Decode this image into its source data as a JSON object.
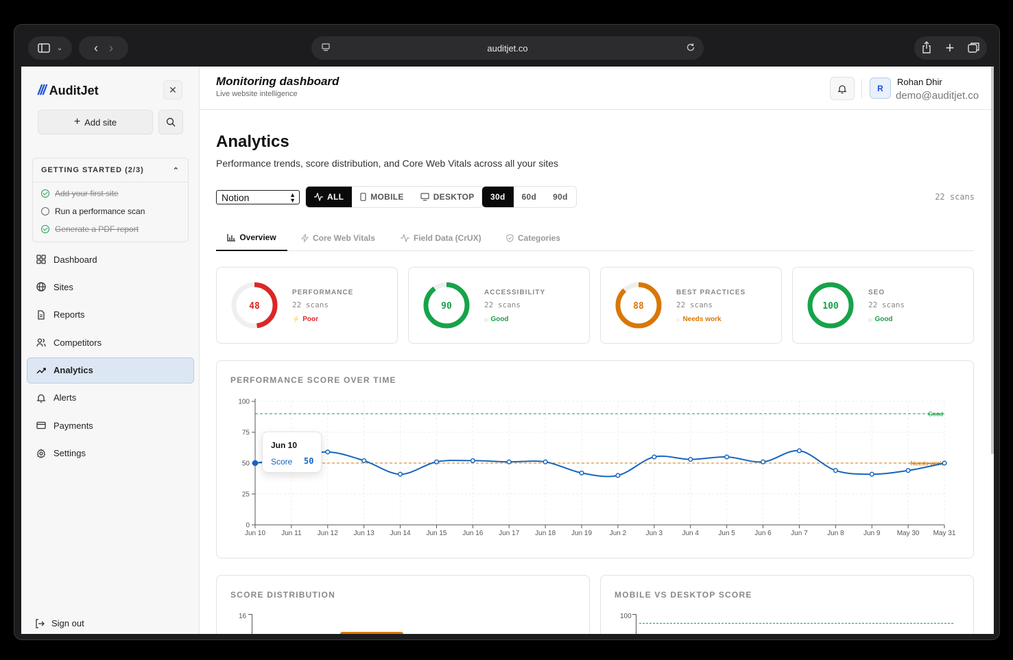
{
  "browser": {
    "url": "auditjet.co"
  },
  "sidebar": {
    "brand": "AuditJet",
    "add_site_label": "Add site",
    "getting_started": {
      "title": "GETTING STARTED (2/3)",
      "items": [
        {
          "label": "Add your first site",
          "done": true
        },
        {
          "label": "Run a performance scan",
          "done": false
        },
        {
          "label": "Generate a PDF report",
          "done": true
        }
      ]
    },
    "nav": [
      {
        "label": "Dashboard",
        "icon": "grid-icon"
      },
      {
        "label": "Sites",
        "icon": "globe-icon"
      },
      {
        "label": "Reports",
        "icon": "document-icon"
      },
      {
        "label": "Competitors",
        "icon": "users-icon"
      },
      {
        "label": "Analytics",
        "icon": "trend-icon",
        "active": true
      },
      {
        "label": "Alerts",
        "icon": "bell-icon"
      },
      {
        "label": "Payments",
        "icon": "card-icon"
      },
      {
        "label": "Settings",
        "icon": "gear-icon"
      }
    ],
    "sign_out_label": "Sign out"
  },
  "header": {
    "title": "Monitoring dashboard",
    "subtitle": "Live website intelligence",
    "user_initial": "R",
    "user_name": "Rohan Dhir",
    "user_email": "demo@auditjet.co"
  },
  "page": {
    "title": "Analytics",
    "description": "Performance trends, score distribution, and Core Web Vitals across all your sites",
    "site_select": "Notion",
    "device_options": [
      "ALL",
      "MOBILE",
      "DESKTOP"
    ],
    "device_selected": "ALL",
    "range_options": [
      "30d",
      "60d",
      "90d"
    ],
    "range_selected": "30d",
    "scans_total": "22 scans"
  },
  "tabs": [
    "Overview",
    "Core Web Vitals",
    "Field Data (CrUX)",
    "Categories"
  ],
  "active_tab": "Overview",
  "scores": [
    {
      "label": "PERFORMANCE",
      "value": 48,
      "value_text": "48",
      "scans": "22 scans",
      "status": "Poor",
      "color": "#dc2626"
    },
    {
      "label": "ACCESSIBILITY",
      "value": 90,
      "value_text": "90",
      "scans": "22 scans",
      "status": "Good",
      "color": "#16a34a"
    },
    {
      "label": "BEST PRACTICES",
      "value": 88,
      "value_text": "88",
      "scans": "22 scans",
      "status": "Needs work",
      "color": "#d97706"
    },
    {
      "label": "SEO",
      "value": 100,
      "value_text": "100",
      "scans": "22 scans",
      "status": "Good",
      "color": "#16a34a"
    }
  ],
  "chart_data": [
    {
      "type": "line",
      "title": "PERFORMANCE SCORE OVER TIME",
      "x": [
        "Jun 10",
        "Jun 11",
        "Jun 12",
        "Jun 13",
        "Jun 14",
        "Jun 15",
        "Jun 16",
        "Jun 17",
        "Jun 18",
        "Jun 19",
        "Jun 2",
        "Jun 3",
        "Jun 4",
        "Jun 5",
        "Jun 6",
        "Jun 7",
        "Jun 8",
        "Jun 9",
        "May 30",
        "May 31"
      ],
      "series": [
        {
          "values": [
            50,
            54,
            59,
            52,
            41,
            51,
            52,
            51,
            51,
            42,
            40,
            55,
            53,
            55,
            51,
            60,
            44,
            41,
            44,
            50
          ],
          "color": "#1565c0"
        }
      ],
      "reference_lines": [
        {
          "label": "Good",
          "value": 90,
          "color": "#16a34a"
        },
        {
          "label": "Needs work",
          "value": 50,
          "color": "#d97706"
        }
      ],
      "yticks": [
        0,
        25,
        50,
        75,
        100
      ],
      "ylim": [
        0,
        100
      ],
      "grid": true,
      "tooltip": {
        "date": "Jun 10",
        "label": "Score",
        "value": "50"
      }
    },
    {
      "type": "bar",
      "title": "SCORE DISTRIBUTION",
      "yticks": [
        16
      ]
    },
    {
      "type": "line",
      "title": "MOBILE VS DESKTOP SCORE",
      "yticks": [
        100
      ]
    }
  ]
}
